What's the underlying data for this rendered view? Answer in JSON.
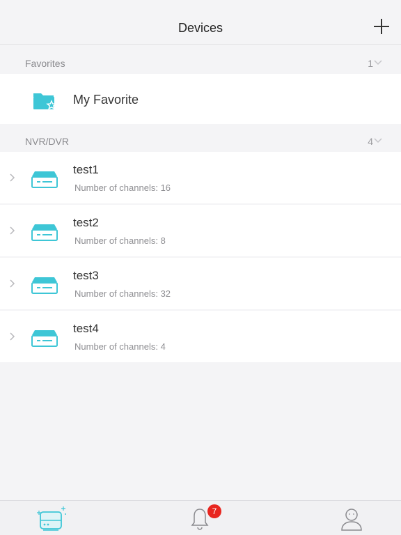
{
  "header": {
    "title": "Devices",
    "add_icon": "plus-icon"
  },
  "sections": {
    "favorites": {
      "label": "Favorites",
      "count": "1"
    },
    "nvr": {
      "label": "NVR/DVR",
      "count": "4"
    }
  },
  "favorite": {
    "label": "My Favorite",
    "icon": "favorite-folder-icon"
  },
  "devices": [
    {
      "name": "test1",
      "channels": "Number of channels: 16"
    },
    {
      "name": "test2",
      "channels": "Number of channels: 8"
    },
    {
      "name": "test3",
      "channels": "Number of channels: 32"
    },
    {
      "name": "test4",
      "channels": "Number of channels: 4"
    }
  ],
  "tabbar": {
    "tabs": [
      {
        "icon": "devices-tab-icon",
        "selected": true
      },
      {
        "icon": "bell-icon",
        "selected": false
      },
      {
        "icon": "user-icon",
        "selected": false
      }
    ],
    "notification_badge": "7"
  },
  "colors": {
    "accent": "#3ec6d6",
    "badge": "#e8261f",
    "background": "#f4f4f6"
  }
}
